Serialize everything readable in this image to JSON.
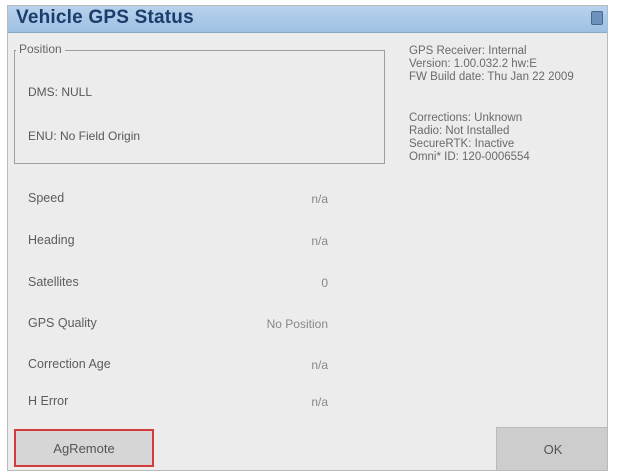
{
  "title": "Vehicle GPS Status",
  "position": {
    "legend": "Position",
    "dms": "DMS: NULL",
    "enu": "ENU: No Field Origin"
  },
  "receiver_info": [
    "GPS Receiver: Internal",
    "Version: 1.00.032.2 hw:E",
    "FW Build date: Thu Jan 22 2009"
  ],
  "corrections_info": [
    "Corrections: Unknown",
    "Radio: Not Installed",
    "SecureRTK: Inactive",
    "Omni* ID: 120-0006554"
  ],
  "status_rows": [
    {
      "label": "Speed",
      "value": "n/a"
    },
    {
      "label": "Heading",
      "value": "n/a"
    },
    {
      "label": "Satellites",
      "value": "0"
    },
    {
      "label": "GPS Quality",
      "value": "No Position"
    },
    {
      "label": "Correction Age",
      "value": "n/a"
    },
    {
      "label": "H Error",
      "value": "n/a"
    }
  ],
  "buttons": {
    "agremote": "AgRemote",
    "ok": "OK"
  }
}
